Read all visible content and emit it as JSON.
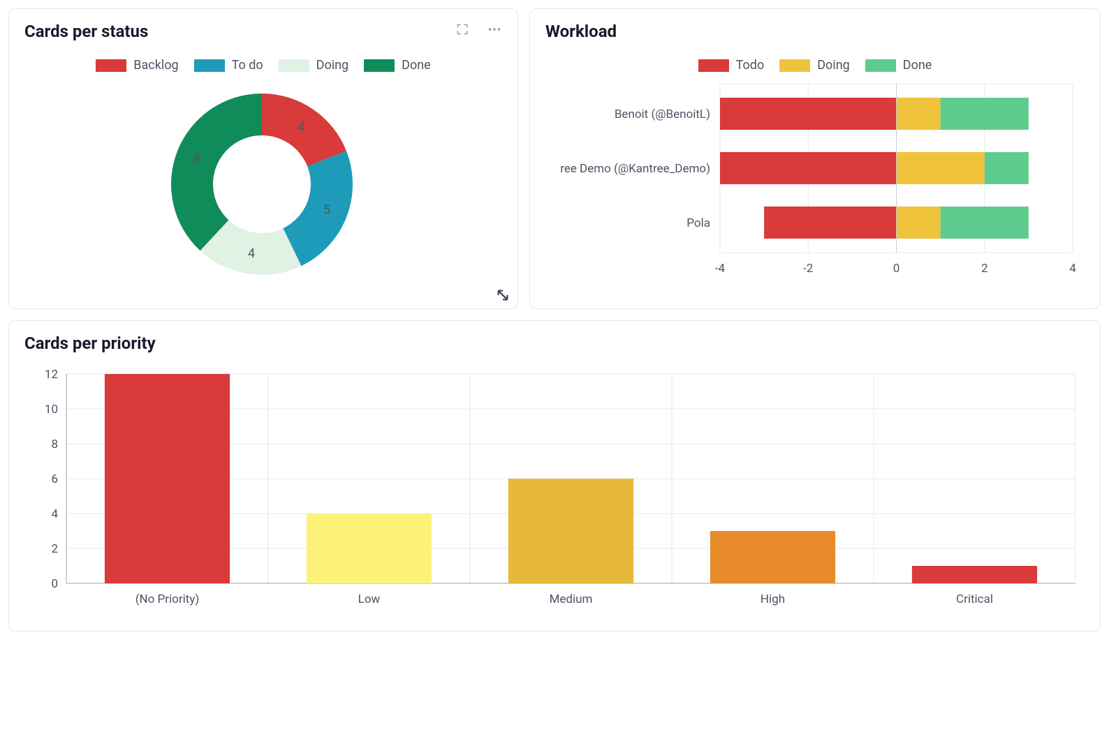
{
  "cards_per_status": {
    "title": "Cards per status",
    "chart_data": {
      "type": "pie",
      "categories": [
        "Backlog",
        "To do",
        "Doing",
        "Done"
      ],
      "values": [
        4,
        5,
        4,
        8
      ],
      "colors": [
        "#d93a3a",
        "#1e9bb8",
        "#dff2e4",
        "#0f8c5a"
      ],
      "donut": true
    }
  },
  "workload": {
    "title": "Workload",
    "chart_data": {
      "type": "bar",
      "orientation": "horizontal-stacked-diverging",
      "categories": [
        "Benoit (@BenoitL)",
        "ree Demo (@Kantree_Demo)",
        "Pola"
      ],
      "series": [
        {
          "name": "Todo",
          "color": "#d93a3a",
          "values": [
            -4,
            -4,
            -3
          ]
        },
        {
          "name": "Doing",
          "color": "#f0c33c",
          "values": [
            1,
            2,
            1
          ]
        },
        {
          "name": "Done",
          "color": "#5ecb8f",
          "values": [
            2,
            1,
            2
          ]
        }
      ],
      "xlim": [
        -4,
        4
      ],
      "xticks": [
        -4,
        -2,
        0,
        2,
        4
      ]
    }
  },
  "cards_per_priority": {
    "title": "Cards per priority",
    "chart_data": {
      "type": "bar",
      "categories": [
        "(No Priority)",
        "Low",
        "Medium",
        "High",
        "Critical"
      ],
      "values": [
        12,
        4,
        6,
        3,
        1
      ],
      "colors": [
        "#d93a3a",
        "#fcf27a",
        "#e7b93a",
        "#e88b2a",
        "#d93a3a"
      ],
      "ylim": [
        0,
        12
      ],
      "yticks": [
        0,
        2,
        4,
        6,
        8,
        10,
        12
      ]
    }
  }
}
